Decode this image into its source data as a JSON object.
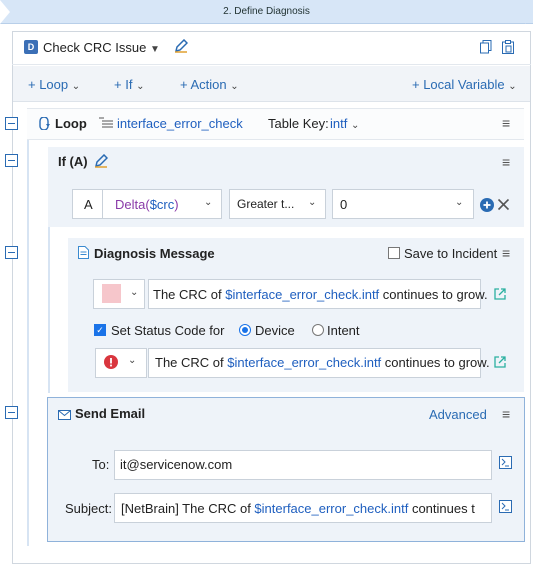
{
  "step_banner": {
    "label": "2. Define Diagnosis"
  },
  "header": {
    "title": "Check CRC Issue",
    "dropdown_icon": "chevron-down-icon",
    "edit_icon": "pencil-icon",
    "copy_icon": "copy-icon",
    "paste_icon": "paste-icon"
  },
  "toolbar": {
    "loop": "+ Loop",
    "if": "+ If",
    "action": "+ Action",
    "local_variable": "+ Local Variable"
  },
  "loop": {
    "label": "Loop",
    "table": "interface_error_check",
    "table_key_label": "Table Key:",
    "table_key_value": "intf"
  },
  "if_block": {
    "label": "If (A)",
    "condition": {
      "letter": "A",
      "operand_prefix": "Delta(",
      "operand_var": "$crc",
      "operand_suffix": ")",
      "operator": "Greater t...",
      "value": "0"
    }
  },
  "diagnosis": {
    "title": "Diagnosis Message",
    "save_label": "Save to Incident",
    "message_prefix": "The CRC of ",
    "message_var": "$interface_error_check.intf",
    "message_suffix": " continues to grow.",
    "set_status_label": "Set Status Code for",
    "device_label": "Device",
    "intent_label": "Intent",
    "status_prefix": "The CRC of ",
    "status_var": "$interface_error_check.intf",
    "status_suffix": " continues to grow."
  },
  "email": {
    "title": "Send Email",
    "advanced": "Advanced",
    "to_label": "To:",
    "to_value": "it@servicenow.com",
    "subject_label": "Subject:",
    "subject_prefix": "[NetBrain] The CRC of ",
    "subject_var": "$interface_error_check.intf",
    "subject_suffix": " continues t"
  },
  "colors": {
    "accent": "#2a6bb3",
    "variable": "#1f5fbf",
    "panel_bg": "#eef3f9",
    "error_red": "#d9363e",
    "swatch_pink": "#f6c6cb"
  }
}
